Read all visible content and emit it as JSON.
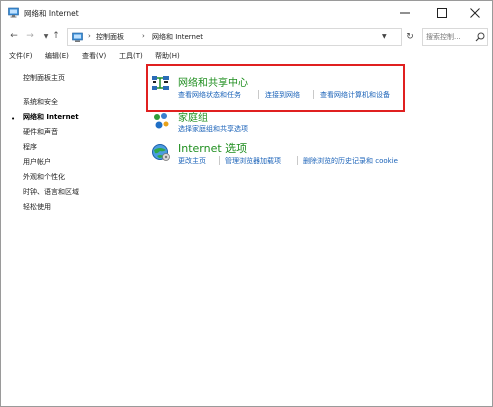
{
  "window": {
    "title": "网络和 Internet"
  },
  "address": {
    "crumbs": [
      "控制面板",
      "网络和 Internet"
    ],
    "search_placeholder": "搜索控制..."
  },
  "menu": [
    "文件(F)",
    "编辑(E)",
    "查看(V)",
    "工具(T)",
    "帮助(H)"
  ],
  "sidebar": {
    "items": [
      {
        "label": "控制面板主页",
        "current": false
      },
      {
        "label": "系统和安全",
        "current": false
      },
      {
        "label": "网络和 Internet",
        "current": true
      },
      {
        "label": "硬件和声音",
        "current": false
      },
      {
        "label": "程序",
        "current": false
      },
      {
        "label": "用户帐户",
        "current": false
      },
      {
        "label": "外观和个性化",
        "current": false
      },
      {
        "label": "时钟、语言和区域",
        "current": false
      },
      {
        "label": "轻松使用",
        "current": false
      }
    ]
  },
  "categories": [
    {
      "title": "网络和共享中心",
      "icon": "network-sharing-center-icon",
      "tasks": [
        "查看网络状态和任务",
        "连接到网络",
        "查看网络计算机和设备"
      ]
    },
    {
      "title": "家庭组",
      "icon": "homegroup-icon",
      "tasks": [
        "选择家庭组和共享选项"
      ]
    },
    {
      "title": "Internet 选项",
      "icon": "internet-options-icon",
      "tasks": [
        "更改主页",
        "管理浏览器加载项",
        "删除浏览的历史记录和 cookie"
      ]
    }
  ],
  "colors": {
    "category_title": "#1e8e1e",
    "task_link": "#1a62b8",
    "highlight": "#e02020"
  }
}
